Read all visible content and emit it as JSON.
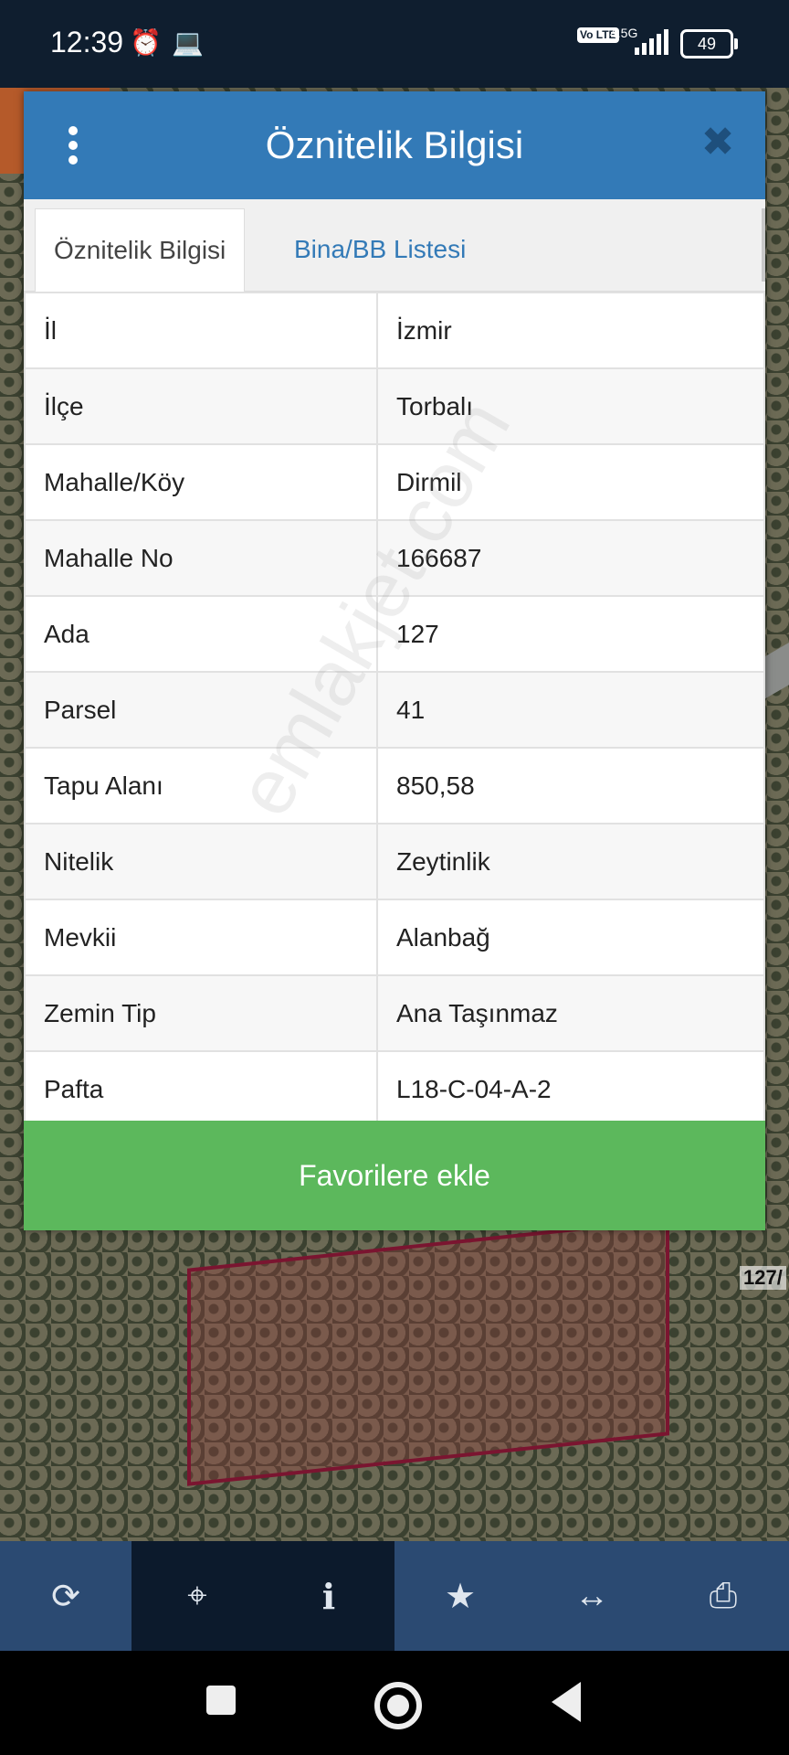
{
  "status_bar": {
    "time": "12:39",
    "network_type": "4.5G",
    "network_badge": "Vo LTE",
    "battery": "49"
  },
  "modal": {
    "title": "Öznitelik Bilgisi",
    "tabs": [
      {
        "label": "Öznitelik Bilgisi",
        "active": true
      },
      {
        "label": "Bina/BB Listesi",
        "active": false
      }
    ],
    "rows": [
      {
        "key": "İl",
        "value": "İzmir"
      },
      {
        "key": "İlçe",
        "value": "Torbalı"
      },
      {
        "key": "Mahalle/Köy",
        "value": "Dirmil"
      },
      {
        "key": "Mahalle No",
        "value": "166687"
      },
      {
        "key": "Ada",
        "value": "127"
      },
      {
        "key": "Parsel",
        "value": "41"
      },
      {
        "key": "Tapu Alanı",
        "value": "850,58"
      },
      {
        "key": "Nitelik",
        "value": "Zeytinlik"
      },
      {
        "key": "Mevkii",
        "value": "Alanbağ"
      },
      {
        "key": "Zemin Tip",
        "value": "Ana Taşınmaz"
      },
      {
        "key": "Pafta",
        "value": "L18-C-04-A-2"
      }
    ],
    "favorite_button": "Favorilere ekle"
  },
  "watermark": "emlakjet.com",
  "map_label": "127/",
  "toolbar": {
    "items": [
      {
        "icon": "refresh-icon",
        "glyph": "⟳"
      },
      {
        "icon": "crosshair-icon",
        "glyph": "⌖"
      },
      {
        "icon": "info-icon",
        "glyph": "i"
      },
      {
        "icon": "star-icon",
        "glyph": "★"
      },
      {
        "icon": "measure-icon",
        "glyph": "↔"
      },
      {
        "icon": "print-icon",
        "glyph": "⎙"
      }
    ],
    "active_items": [
      1,
      2
    ]
  },
  "colors": {
    "header": "#337ab7",
    "button": "#5cb85c",
    "toolbar": "#2b4a72",
    "toolbar_active": "#0c1a2c"
  }
}
